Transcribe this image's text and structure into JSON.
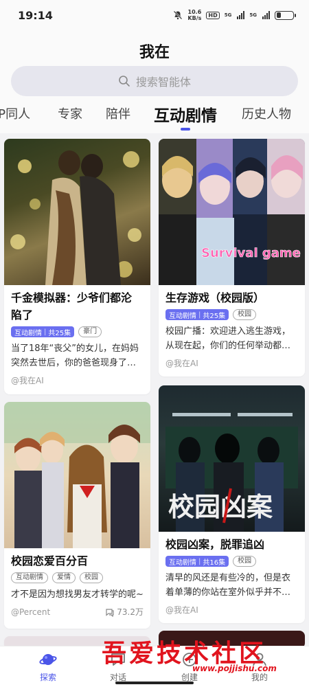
{
  "statusbar": {
    "time": "19:14",
    "speed_top": "10.6",
    "speed_bottom": "KB/s",
    "hd": "HD",
    "sim1": "5G",
    "sim2": "5G"
  },
  "header": {
    "title": "我在",
    "search_placeholder": "搜索智能体"
  },
  "tabs": [
    "IP同人",
    "专家",
    "陪伴",
    "互动剧情",
    "历史人物"
  ],
  "active_tab": "互动剧情",
  "accent_color": "#4b55e8",
  "cards": [
    {
      "title_l1": "千金模拟器：少爷们都沦",
      "title_l2": "陷了",
      "tag_main": "互动剧情",
      "episodes": "共25集",
      "tag_extra": "豪门",
      "desc_l1": "当了18年“丧父”的女儿，在妈妈",
      "desc_l2": "突然去世后，你的爸爸现身了…",
      "author": "@我在AI"
    },
    {
      "title": "生存游戏（校园版）",
      "tag_main": "互动剧情",
      "episodes": "共25集",
      "tag_extra": "校园",
      "desc_l1": "校园广播：欢迎进入逃生游戏，",
      "desc_l2": "从现在起，你们的任何举动都…",
      "author": "@我在AI",
      "image_text": "Survival game"
    },
    {
      "title": "校园恋爱百分百",
      "tags": [
        "互动剧情",
        "爱情",
        "校园"
      ],
      "desc": "才不是因为想找男友才转学的呢~",
      "author": "@Percent",
      "views": "73.2万"
    },
    {
      "title": "校园凶案，脱罪追凶",
      "tag_main": "互动剧情",
      "episodes": "共16集",
      "tag_extra": "校园",
      "desc_l1": "清早的风还是有些冷的，但是衣",
      "desc_l2": "着单薄的你站在室外似乎并不…",
      "author": "@我在AI",
      "image_text": "校园凶案"
    }
  ],
  "bottom_nav": [
    {
      "label": "探索",
      "icon": "planet-icon"
    },
    {
      "label": "对话",
      "icon": "chat-icon"
    },
    {
      "label": "创建",
      "icon": "create-icon"
    },
    {
      "label": "我的",
      "icon": "profile-icon"
    }
  ],
  "watermark": {
    "text": "吾爱技术社区",
    "url": "www.pojjishu.com"
  }
}
